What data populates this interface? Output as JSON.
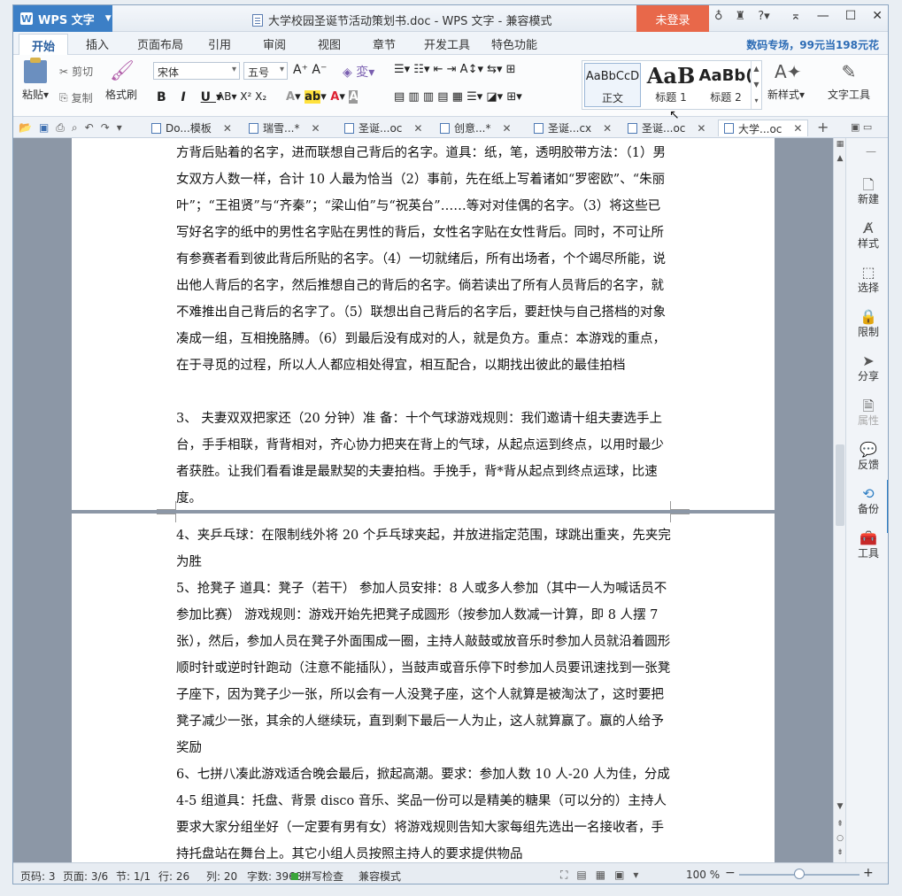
{
  "app": {
    "name": "WPS 文字",
    "title": "大学校园圣诞节活动策划书.doc - WPS 文字 - 兼容模式",
    "login": "未登录"
  },
  "tabs": [
    "开始",
    "插入",
    "页面布局",
    "引用",
    "审阅",
    "视图",
    "章节",
    "开发工具",
    "特色功能"
  ],
  "promo": "数码专场，99元当198元花",
  "ribbon": {
    "paste": "粘贴",
    "cut": "剪切",
    "copy": "复制",
    "format_painter": "格式刷",
    "font": "宋体",
    "size": "五号",
    "styles": [
      {
        "sample": "AaBbCcD",
        "name": "正文"
      },
      {
        "sample": "AaB",
        "name": "标题 1"
      },
      {
        "sample": "AaBb(",
        "name": "标题 2"
      }
    ],
    "new_style": "新样式",
    "text_tools": "文字工具"
  },
  "doc_tabs": [
    "Do...模板",
    "瑞雪...*",
    "圣诞...oc",
    "创意...*",
    "圣诞...cx",
    "圣诞...oc",
    "大学...oc"
  ],
  "document": {
    "page1": [
      "方背后贴着的名字，进而联想自己背后的名字。道具：纸，笔，透明胶带方法：（1）男女双方人数一样，合计 10 人最为恰当（2）事前，先在纸上写着诸如“罗密欧”、“朱丽叶”；“王祖贤”与“齐秦”；“梁山伯”与“祝英台”……等对对佳偶的名字。（3）将这些已写好名字的纸中的男性名字贴在男性的背后，女性名字贴在女性背后。同时，不可让所有参赛者看到彼此背后所贴的名字。（4）一切就绪后，所有出场者，个个竭尽所能，说出他人背后的名字，然后推想自己的背后的名字。倘若读出了所有人员背后的名字，就不难推出自己背后的名字了。（5）联想出自己背后的名字后，要赶快与自己搭档的对象凑成一组，互相挽胳膊。（6）到最后没有成对的人，就是负方。重点：本游戏的重点，在于寻觅的过程，所以人人都应相处得宜，相互配合，以期找出彼此的最佳拍档",
      "3、 夫妻双双把家还（20 分钟）准 备：十个气球游戏规则：我们邀请十组夫妻选手上台，手手相联，背背相对，齐心协力把夹在背上的气球，从起点运到终点，以用时最少者获胜。让我们看看谁是最默契的夫妻拍档。手挽手，背*背从起点到终点运球，比速度。"
    ],
    "page2": [
      "4、夹乒乓球：在限制线外将 20 个乒乓球夹起，并放进指定范围，球跳出重夹，先夹完为胜",
      "5、抢凳子   道具：凳子（若干）   参加人员安排：8 人或多人参加（其中一人为喊话员不参加比赛）  游戏规则：游戏开始先把凳子成圆形（按参加人数减一计算，即 8 人摆 7 张），然后，参加人员在凳子外面围成一圈，主持人敲鼓或放音乐时参加人员就沿着圆形顺时针或逆时针跑动（注意不能插队），当鼓声或音乐停下时参加人员要讯速找到一张凳子座下，因为凳子少一张，所以会有一人没凳子座，这个人就算是被淘汰了，这时要把凳子减少一张，其余的人继续玩，直到剩下最后一人为止，这人就算赢了。赢的人给予奖励",
      "6、七拼八凑此游戏适合晚会最后，掀起高潮。要求：参加人数 10 人-20 人为佳，分成 4-5 组道具：托盘、背景 disco 音乐、奖品一份可以是精美的糖果（可以分的）主持人要求大家分组坐好（一定要有男有女）将游戏规则告知大家每组先选出一名接收者，手持托盘站在舞台上。其它小组人员按照主持人的要求提供物品"
    ]
  },
  "side_panel": [
    {
      "icon": "new-icon",
      "label": "新建"
    },
    {
      "icon": "style-icon",
      "label": "样式"
    },
    {
      "icon": "select-icon",
      "label": "选择"
    },
    {
      "icon": "limit-icon",
      "label": "限制"
    },
    {
      "icon": "share-icon",
      "label": "分享"
    },
    {
      "icon": "property-icon",
      "label": "属性"
    },
    {
      "icon": "feedback-icon",
      "label": "反馈"
    },
    {
      "icon": "backup-icon",
      "label": "备份"
    },
    {
      "icon": "tools-icon",
      "label": "工具"
    }
  ],
  "status": {
    "page_no": "页码: 3",
    "pages": "页面: 3/6",
    "section": "节: 1/1",
    "row": "行: 26",
    "col": "列: 20",
    "words": "字数: 3968",
    "spell": "拼写检查",
    "mode": "兼容模式",
    "zoom": "100 %"
  }
}
